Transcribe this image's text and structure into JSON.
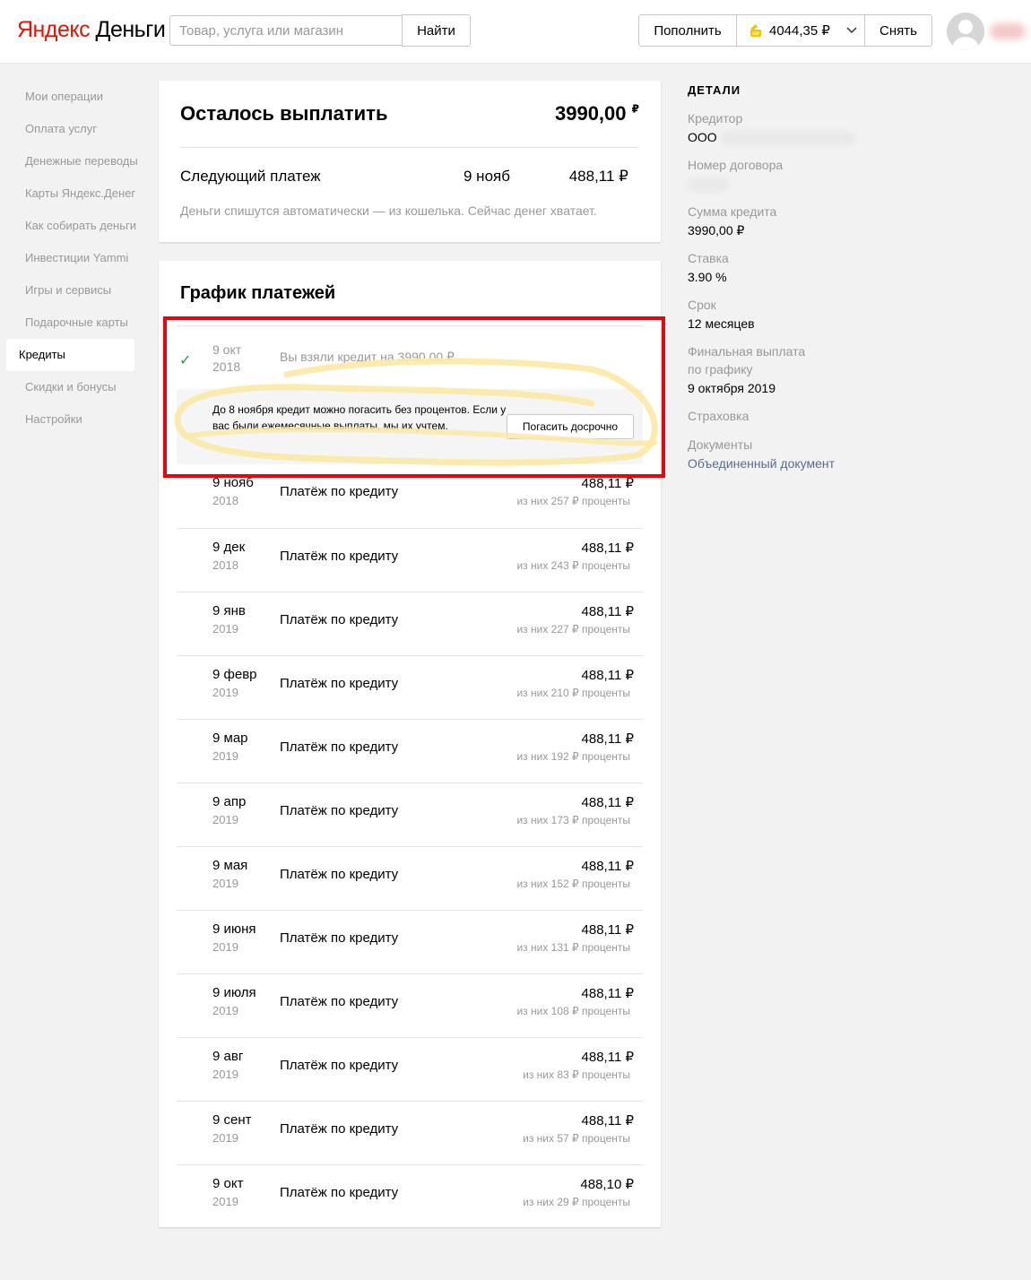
{
  "header": {
    "logo_part1": "Яндекс",
    "logo_part2": "Деньги",
    "search_placeholder": "Товар, услуга или магазин",
    "search_button": "Найти",
    "topup_button": "Пополнить",
    "balance": "4044,35 ₽",
    "withdraw_button": "Снять"
  },
  "sidebar": {
    "items": [
      {
        "label": "Мои операции"
      },
      {
        "label": "Оплата услуг"
      },
      {
        "label": "Денежные переводы"
      },
      {
        "label": "Карты Яндекс.Денег"
      },
      {
        "label": "Как собирать деньги"
      },
      {
        "label": "Инвестиции Yammi"
      },
      {
        "label": "Игры и сервисы"
      },
      {
        "label": "Подарочные карты"
      },
      {
        "label": "Кредиты"
      },
      {
        "label": "Скидки и бонусы"
      },
      {
        "label": "Настройки"
      }
    ],
    "active_index": 8
  },
  "summary": {
    "title": "Осталось выплатить",
    "amount": "3990,00",
    "currency": "₽",
    "next_label": "Следующий платеж",
    "next_date": "9 нояб",
    "next_amount": "488,11 ₽",
    "note": "Деньги спишутся автоматически — из кошелька. Сейчас денег хватает."
  },
  "schedule": {
    "title": "График платежей",
    "first": {
      "month": "9 окт",
      "year": "2018",
      "desc": "Вы взяли кредит на 3990,00 ₽"
    },
    "promo": {
      "text": "До 8 ноября кредит можно погасить без процентов. Если у вас были ежемесячные выплаты, мы их учтем.",
      "button": "Погасить досрочно"
    },
    "rows": [
      {
        "month": "9 нояб",
        "year": "2018",
        "desc": "Платёж по кредиту",
        "amount": "488,11 ₽",
        "interest": "из них 257 ₽ проценты"
      },
      {
        "month": "9 дек",
        "year": "2018",
        "desc": "Платёж по кредиту",
        "amount": "488,11 ₽",
        "interest": "из них 243 ₽ проценты"
      },
      {
        "month": "9 янв",
        "year": "2019",
        "desc": "Платёж по кредиту",
        "amount": "488,11 ₽",
        "interest": "из них 227 ₽ проценты"
      },
      {
        "month": "9 февр",
        "year": "2019",
        "desc": "Платёж по кредиту",
        "amount": "488,11 ₽",
        "interest": "из них 210 ₽ проценты"
      },
      {
        "month": "9 мар",
        "year": "2019",
        "desc": "Платёж по кредиту",
        "amount": "488,11 ₽",
        "interest": "из них 192 ₽ проценты"
      },
      {
        "month": "9 апр",
        "year": "2019",
        "desc": "Платёж по кредиту",
        "amount": "488,11 ₽",
        "interest": "из них 173 ₽ проценты"
      },
      {
        "month": "9 мая",
        "year": "2019",
        "desc": "Платёж по кредиту",
        "amount": "488,11 ₽",
        "interest": "из них 152 ₽ проценты"
      },
      {
        "month": "9 июня",
        "year": "2019",
        "desc": "Платёж по кредиту",
        "amount": "488,11 ₽",
        "interest": "из них 131 ₽ проценты"
      },
      {
        "month": "9 июля",
        "year": "2019",
        "desc": "Платёж по кредиту",
        "amount": "488,11 ₽",
        "interest": "из них 108 ₽ проценты"
      },
      {
        "month": "9 авг",
        "year": "2019",
        "desc": "Платёж по кредиту",
        "amount": "488,11 ₽",
        "interest": "из них 83 ₽ проценты"
      },
      {
        "month": "9 сент",
        "year": "2019",
        "desc": "Платёж по кредиту",
        "amount": "488,11 ₽",
        "interest": "из них 57 ₽ проценты"
      },
      {
        "month": "9 окт",
        "year": "2019",
        "desc": "Платёж по кредиту",
        "amount": "488,10 ₽",
        "interest": "из них 29 ₽ проценты"
      }
    ]
  },
  "details": {
    "heading": "ДЕТАЛИ",
    "creditor_label": "Кредитор",
    "creditor_value": "ООО",
    "contract_label": "Номер договора",
    "sum_label": "Сумма кредита",
    "sum_value": "3990,00 ₽",
    "rate_label": "Ставка",
    "rate_value": "3.90 %",
    "term_label": "Срок",
    "term_value": "12 месяцев",
    "final_label_line1": "Финальная выплата",
    "final_label_line2": "по графику",
    "final_value": "9 октября 2019",
    "insurance_label": "Страховка",
    "documents_label": "Документы",
    "documents_link": "Объединенный документ"
  },
  "colors": {
    "brand_red": "#e61400",
    "annotation_red": "#e8060a",
    "annotation_yellow": "#fbe9a6",
    "check_green": "#2a9a3c",
    "link": "#5a6d8c"
  }
}
